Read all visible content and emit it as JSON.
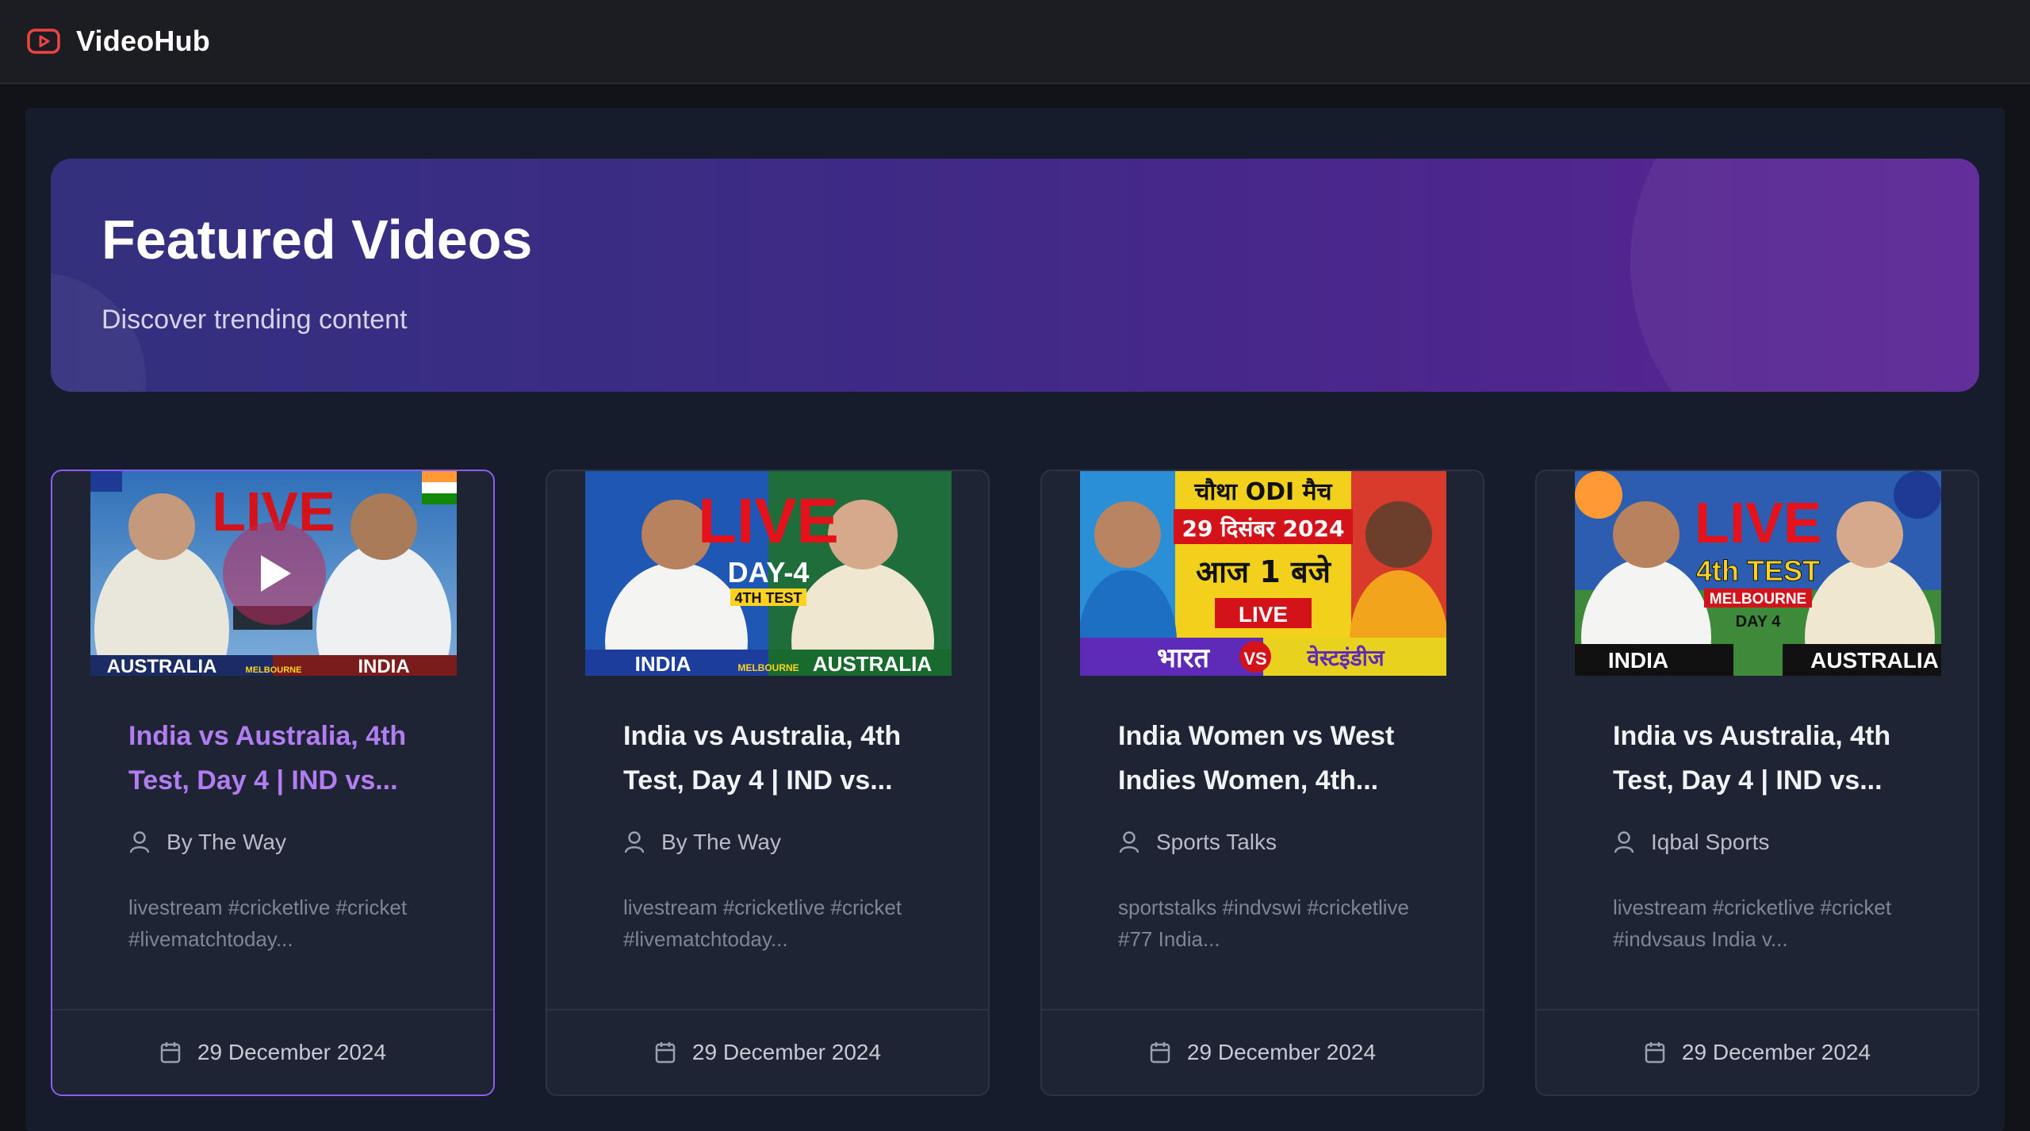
{
  "app": {
    "brand": "VideoHub",
    "logo_icon": "youtube-play-icon",
    "accent": "#8b5cf6"
  },
  "hero": {
    "title": "Featured Videos",
    "subtitle": "Discover trending content"
  },
  "cards": [
    {
      "title": "India vs Australia, 4th Test, Day 4 | IND vs...",
      "author": "By The Way",
      "description": "livestream #cricketlive #cricket #livematchtoday...",
      "date": "29 December 2024",
      "thumb": {
        "headline": "LIVE",
        "left_team": "AUSTRALIA",
        "right_team": "INDIA",
        "venue": "MELBOURNE"
      }
    },
    {
      "title": "India vs Australia, 4th Test, Day 4 | IND vs...",
      "author": "By The Way",
      "description": "livestream #cricketlive #cricket #livematchtoday...",
      "date": "29 December 2024",
      "thumb": {
        "headline": "LIVE",
        "sub1": "DAY-4",
        "sub2": "4TH TEST",
        "left_team": "INDIA",
        "right_team": "AUSTRALIA",
        "venue": "MELBOURNE"
      }
    },
    {
      "title": "India Women vs West Indies Women, 4th...",
      "author": "Sports Talks",
      "description": "sportstalks #indvswi #cricketlive #77 India...",
      "date": "29 December 2024",
      "thumb": {
        "line1": "चौथा ODI मैच",
        "line2": "29 दिसंबर 2024",
        "line3": "आज 1 बजे",
        "badge": "LIVE",
        "left_team": "भारत",
        "vs": "VS",
        "right_team": "वेस्टइंडीज"
      }
    },
    {
      "title": "India vs Australia, 4th Test, Day 4 | IND vs...",
      "author": "Iqbal Sports",
      "description": "livestream #cricketlive #cricket #indvsaus India v...",
      "date": "29 December 2024",
      "thumb": {
        "headline": "LIVE",
        "sub1": "4th TEST",
        "sub2": "MELBOURNE",
        "sub3": "DAY 4",
        "left_team": "INDIA",
        "right_team": "AUSTRALIA"
      }
    }
  ]
}
